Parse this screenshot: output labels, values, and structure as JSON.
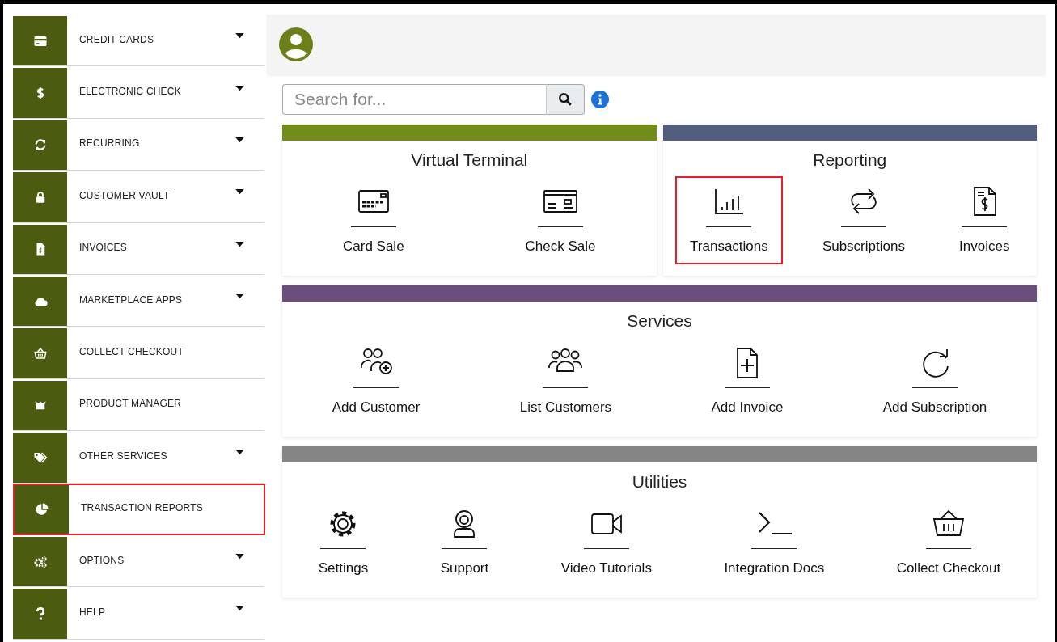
{
  "sidebar": {
    "items": [
      {
        "label": "CREDIT CARDS",
        "has_dropdown": true,
        "highlighted": false
      },
      {
        "label": "ELECTRONIC CHECK",
        "has_dropdown": true,
        "highlighted": false
      },
      {
        "label": "RECURRING",
        "has_dropdown": true,
        "highlighted": false
      },
      {
        "label": "CUSTOMER VAULT",
        "has_dropdown": true,
        "highlighted": false
      },
      {
        "label": "INVOICES",
        "has_dropdown": true,
        "highlighted": false
      },
      {
        "label": "MARKETPLACE APPS",
        "has_dropdown": true,
        "highlighted": false
      },
      {
        "label": "COLLECT CHECKOUT",
        "has_dropdown": false,
        "highlighted": false
      },
      {
        "label": "PRODUCT MANAGER",
        "has_dropdown": false,
        "highlighted": false
      },
      {
        "label": "OTHER SERVICES",
        "has_dropdown": true,
        "highlighted": false
      },
      {
        "label": "TRANSACTION REPORTS",
        "has_dropdown": false,
        "highlighted": true
      },
      {
        "label": "OPTIONS",
        "has_dropdown": true,
        "highlighted": false
      },
      {
        "label": "HELP",
        "has_dropdown": true,
        "highlighted": false
      }
    ]
  },
  "search": {
    "placeholder": "Search for..."
  },
  "rows": [
    {
      "sections": [
        {
          "title": "Virtual Terminal",
          "color": "#728c1b",
          "tiles": [
            {
              "label": "Card Sale",
              "highlighted": false
            },
            {
              "label": "Check Sale",
              "highlighted": false
            }
          ]
        },
        {
          "title": "Reporting",
          "color": "#515e7e",
          "tiles": [
            {
              "label": "Transactions",
              "highlighted": true
            },
            {
              "label": "Subscriptions",
              "highlighted": false
            },
            {
              "label": "Invoices",
              "highlighted": false
            }
          ]
        }
      ]
    },
    {
      "sections": [
        {
          "title": "Services",
          "color": "#6a4e7e",
          "tiles": [
            {
              "label": "Add Customer",
              "highlighted": false
            },
            {
              "label": "List Customers",
              "highlighted": false
            },
            {
              "label": "Add Invoice",
              "highlighted": false
            },
            {
              "label": "Add Subscription",
              "highlighted": false
            }
          ]
        }
      ]
    },
    {
      "sections": [
        {
          "title": "Utilities",
          "color": "#858585",
          "tiles": [
            {
              "label": "Settings",
              "highlighted": false
            },
            {
              "label": "Support",
              "highlighted": false
            },
            {
              "label": "Video Tutorials",
              "highlighted": false
            },
            {
              "label": "Integration Docs",
              "highlighted": false
            },
            {
              "label": "Collect Checkout",
              "highlighted": false
            }
          ]
        }
      ]
    }
  ]
}
